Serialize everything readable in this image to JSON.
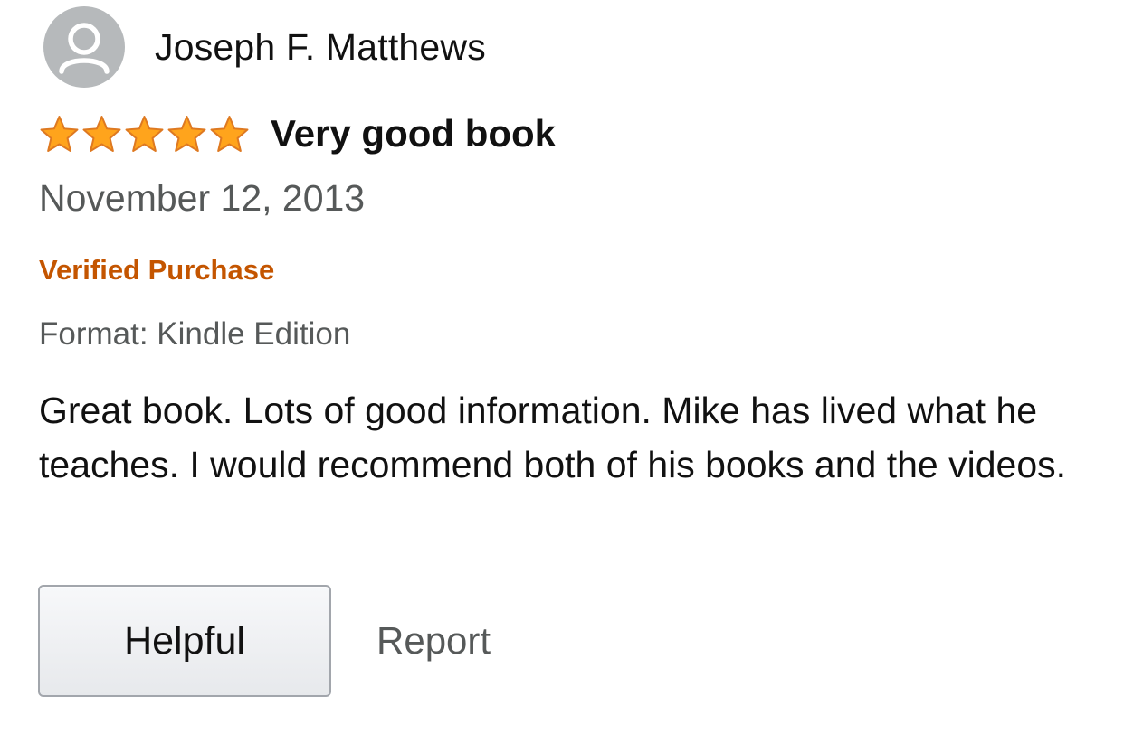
{
  "review": {
    "author": "Joseph F. Matthews",
    "avatar_icon": "default-user-silhouette-icon",
    "rating": 5,
    "rating_max": 5,
    "star_color": "#ffa41c",
    "headline": "Very good book",
    "date": "November 12, 2013",
    "verified_label": "Verified Purchase",
    "verified_color": "#c45500",
    "format": "Format: Kindle Edition",
    "body": "Great book. Lots of good information. Mike has lived what he teaches. I would recommend both of his books and the videos.",
    "actions": {
      "helpful_label": "Helpful",
      "report_label": "Report"
    }
  }
}
